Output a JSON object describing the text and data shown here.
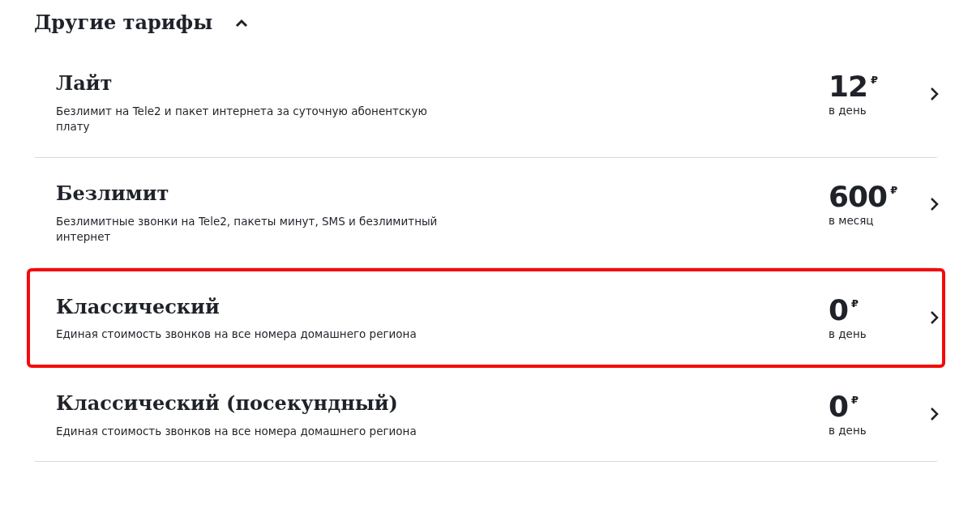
{
  "section": {
    "title": "Другие тарифы",
    "expanded": true
  },
  "tariffs": [
    {
      "name": "Лайт",
      "description": "Безлимит на Tele2 и пакет интернета за суточную абонентскую плату",
      "price": "12",
      "currency": "₽",
      "period": "в день",
      "highlighted": false
    },
    {
      "name": "Безлимит",
      "description": "Безлимитные звонки на Tele2, пакеты минут, SMS и безлимитный интернет",
      "price": "600",
      "currency": "₽",
      "period": "в месяц",
      "highlighted": false
    },
    {
      "name": "Классический",
      "description": "Единая стоимость звонков на все номера домашнего региона",
      "price": "0",
      "currency": "₽",
      "period": "в день",
      "highlighted": true
    },
    {
      "name": "Классический (посекундный)",
      "description": "Единая стоимость звонков на все номера домашнего региона",
      "price": "0",
      "currency": "₽",
      "period": "в день",
      "highlighted": false
    }
  ]
}
